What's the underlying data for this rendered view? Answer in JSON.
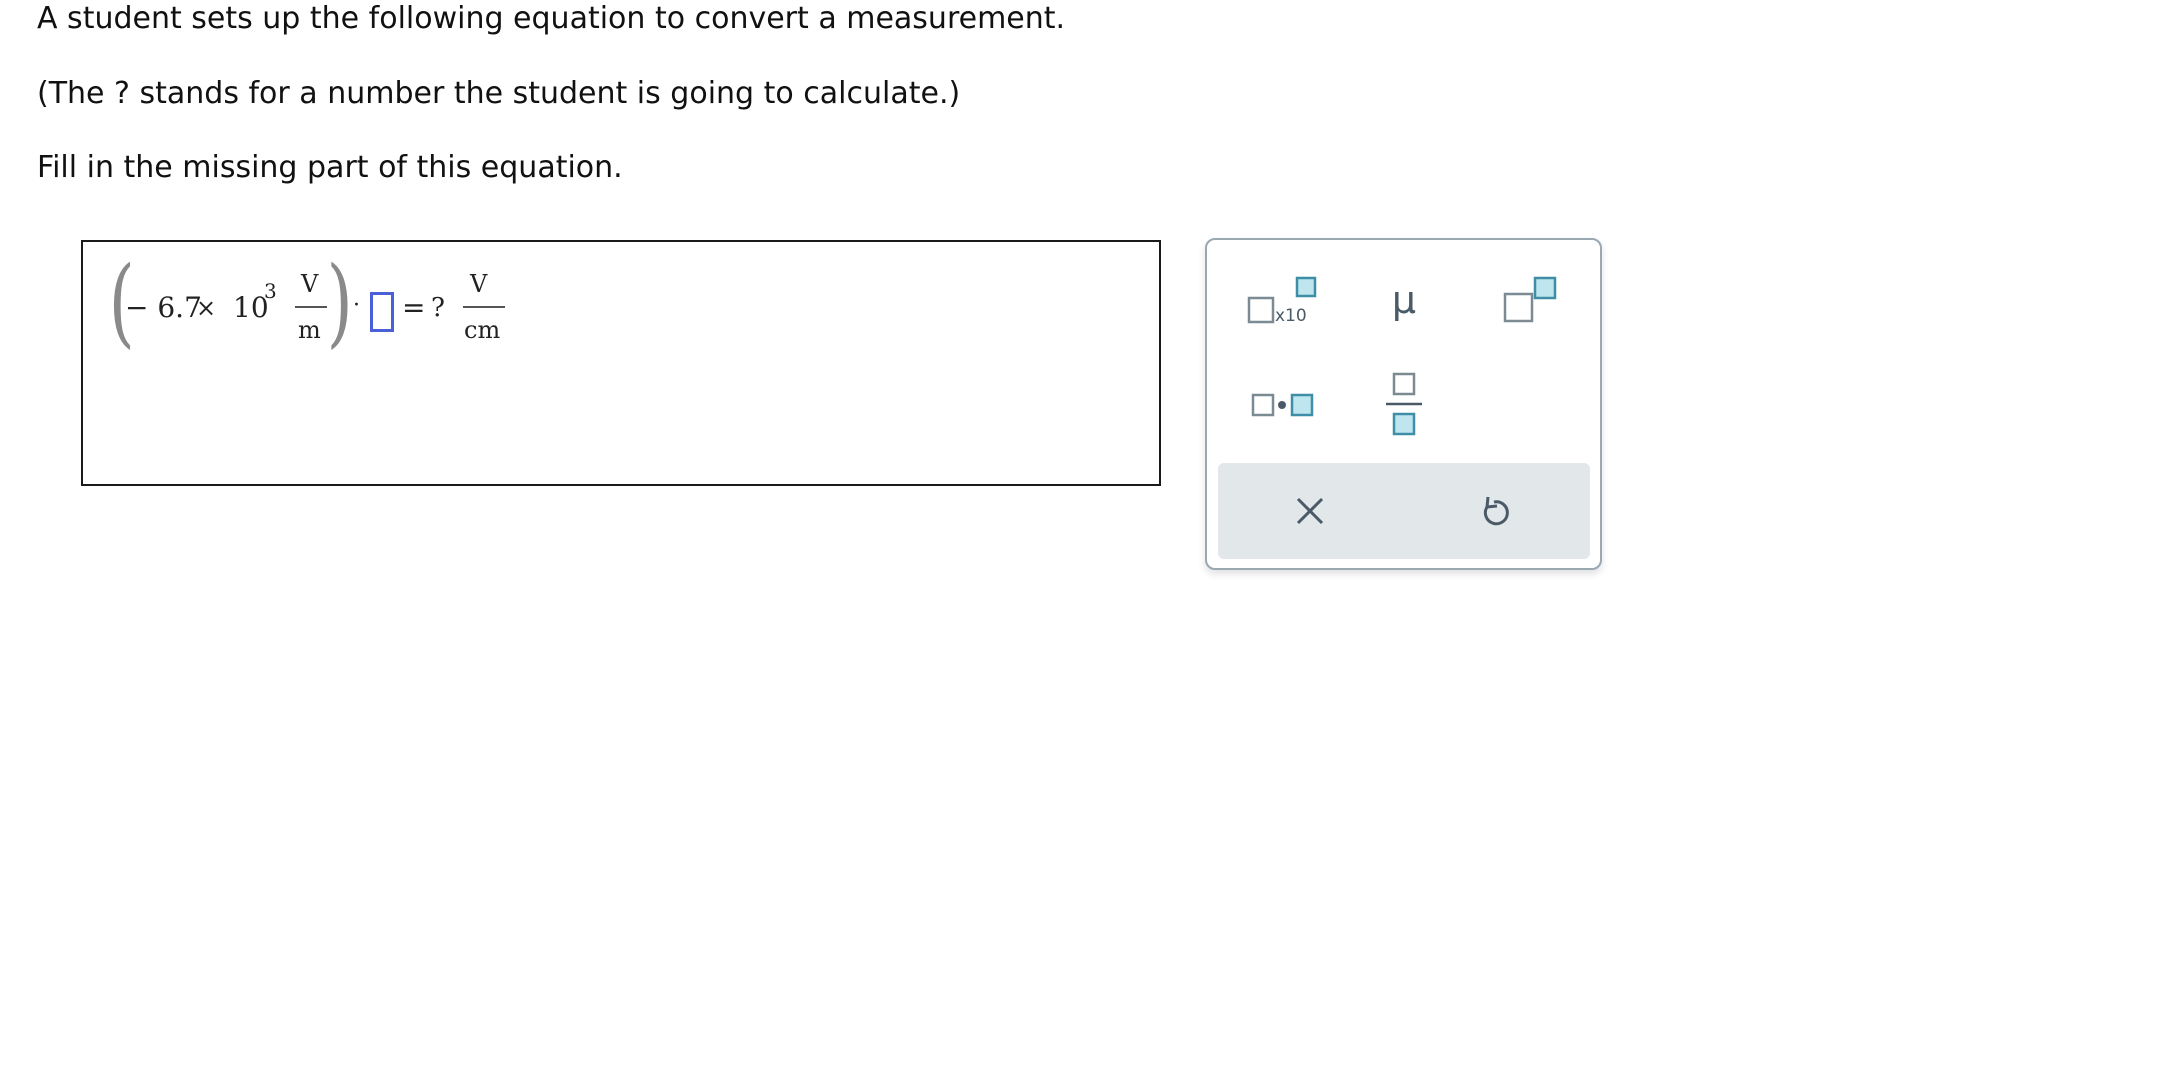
{
  "prompt": {
    "line1": "A student sets up the following equation to convert a measurement.",
    "line2": "(The ? stands for a number the student is going to calculate.)",
    "line3": "Fill in the missing part of this equation."
  },
  "equation": {
    "coefficient": "− 6.7",
    "times": "×",
    "base": "10",
    "exponent": "3",
    "left_unit_numerator": "V",
    "left_unit_denominator": "m",
    "dot": "·",
    "equals": "=",
    "unknown": "?",
    "right_unit_numerator": "V",
    "right_unit_denominator": "cm"
  },
  "toolbar": {
    "sci_notation_label": "x10",
    "mu_symbol": "μ",
    "icons": {
      "sci": "scientific-notation-icon",
      "mu": "mu-icon",
      "superscript": "superscript-icon",
      "multiply": "multiplication-dot-icon",
      "fraction": "fraction-icon",
      "clear": "clear-icon",
      "undo": "undo-icon"
    },
    "colors": {
      "accent_fill": "#bfe6ee",
      "accent_stroke": "#3d8ea6",
      "icon_gray": "#7c8a94",
      "footer_bg": "#e2e7ea",
      "cursor_box": "#4a5fd8"
    }
  }
}
